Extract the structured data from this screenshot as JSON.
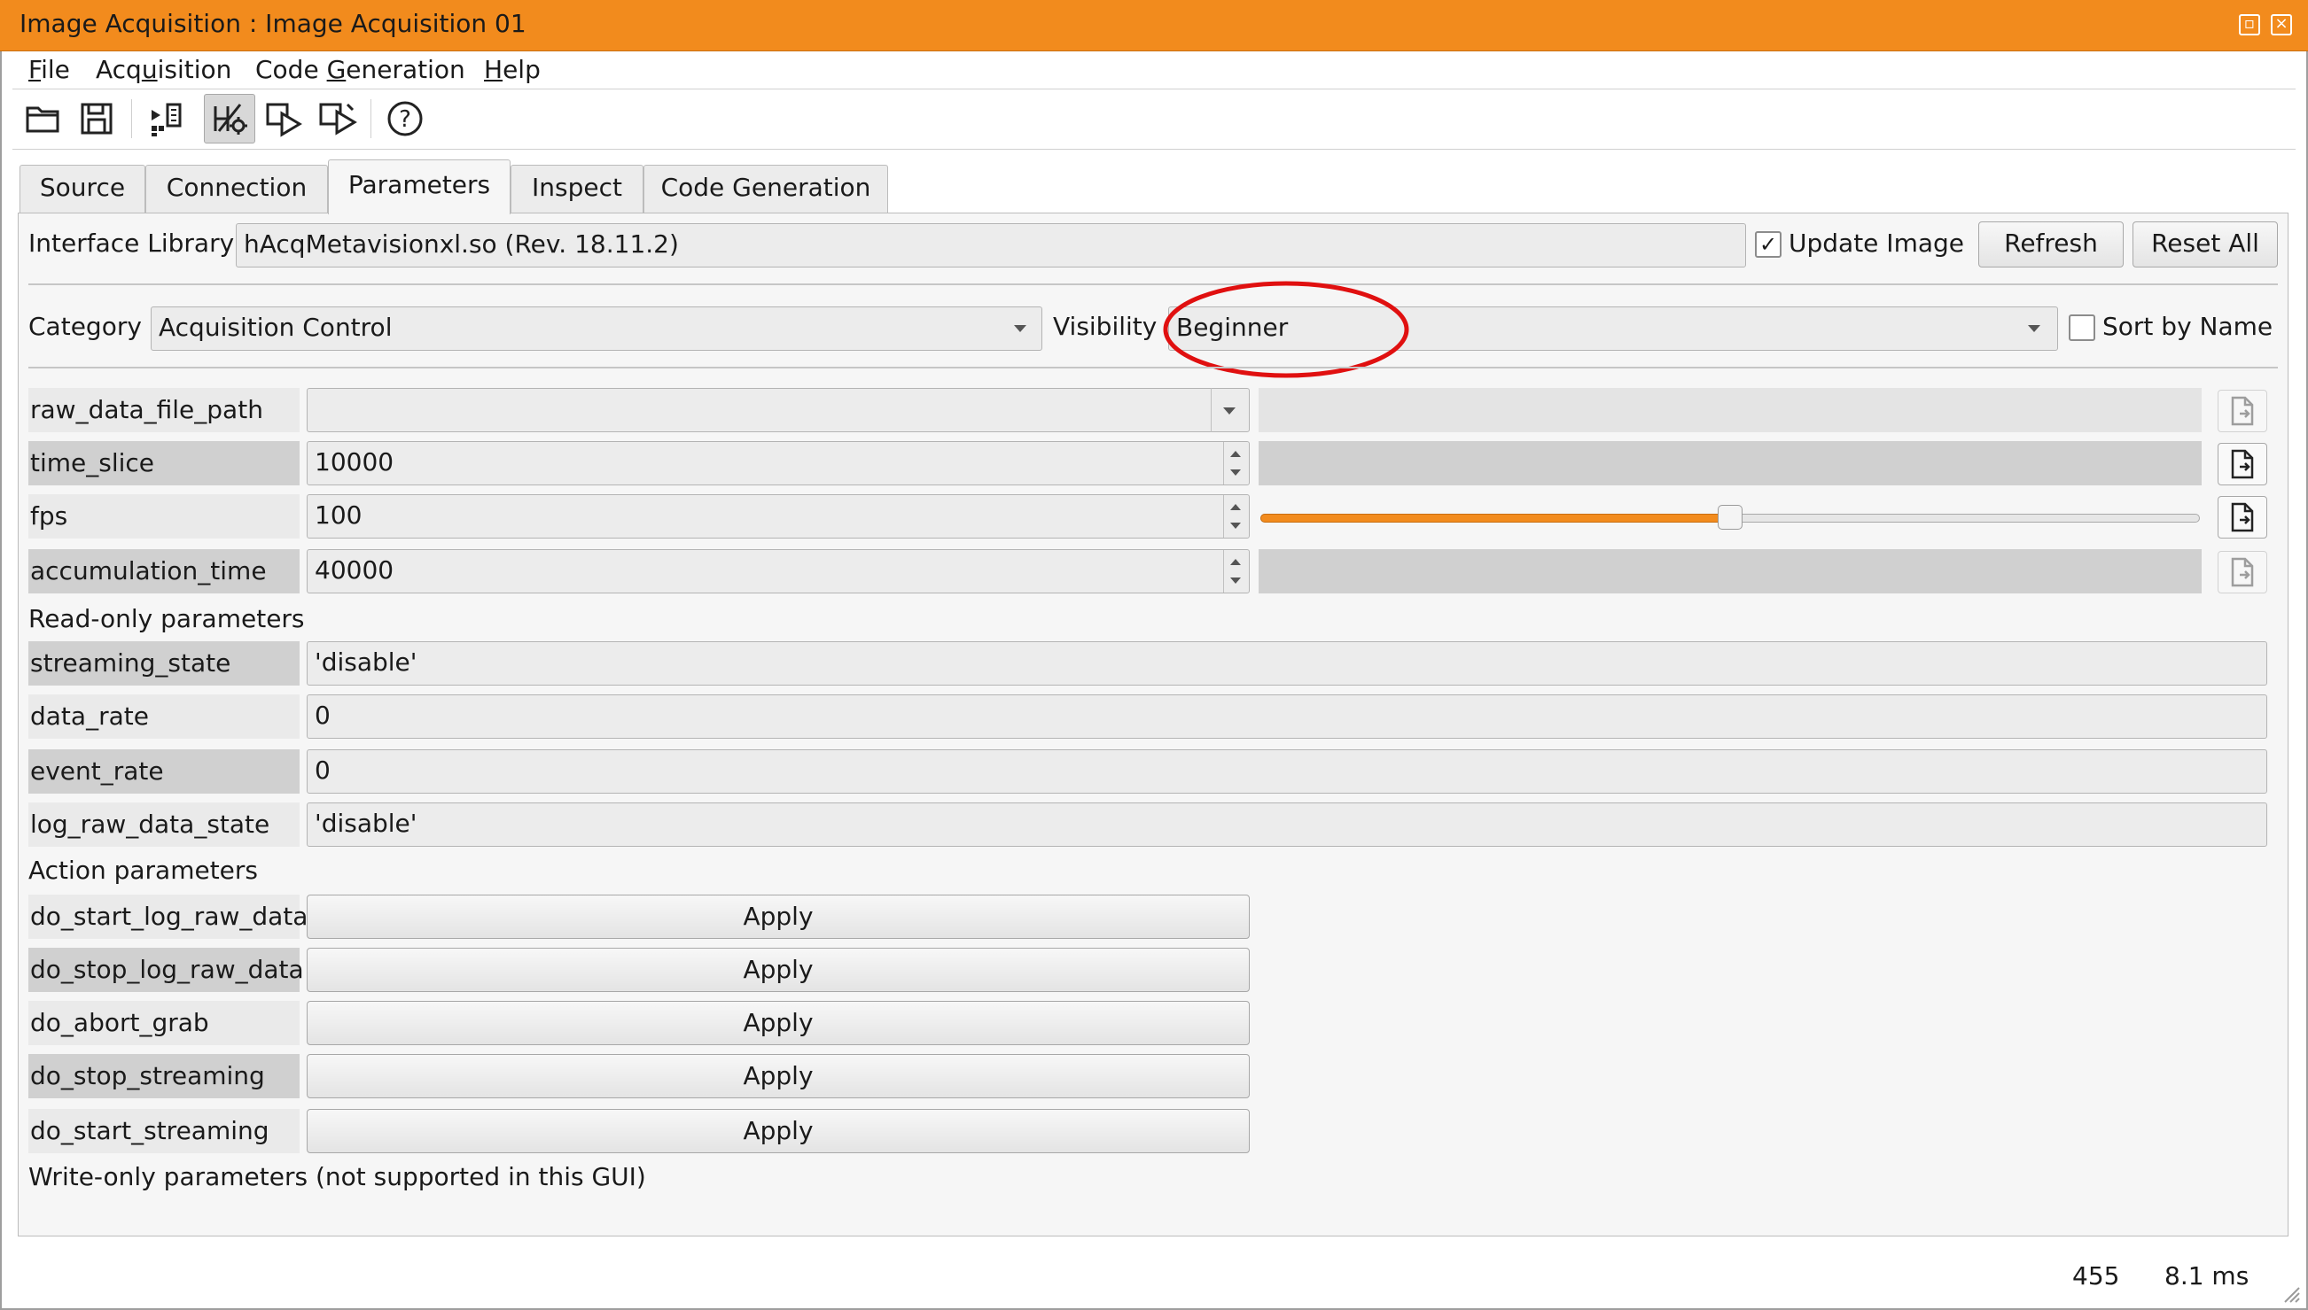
{
  "window": {
    "title": "Image Acquisition : Image Acquisition 01",
    "accent_color": "#f28b1d"
  },
  "menu": {
    "items": [
      {
        "label": "File"
      },
      {
        "label": "Acquisition"
      },
      {
        "label": "Code Generation"
      },
      {
        "label": "Help"
      }
    ]
  },
  "toolbar": {
    "buttons": [
      {
        "icon": "open-folder-icon"
      },
      {
        "icon": "save-disk-icon"
      },
      {
        "icon": "detect-devices-icon"
      },
      {
        "icon": "acquisition-settings-icon",
        "active": true
      },
      {
        "icon": "snap-image-icon"
      },
      {
        "icon": "live-image-icon"
      },
      {
        "icon": "help-icon"
      }
    ]
  },
  "tabs": [
    {
      "label": "Source"
    },
    {
      "label": "Connection"
    },
    {
      "label": "Parameters",
      "active": true
    },
    {
      "label": "Inspect"
    },
    {
      "label": "Code Generation"
    }
  ],
  "interface": {
    "label": "Interface Library",
    "value": "hAcqMetavisionxl.so (Rev. 18.11.2)",
    "update_image_label": "Update Image",
    "update_image_checked": true,
    "refresh_label": "Refresh",
    "reset_all_label": "Reset All"
  },
  "filter": {
    "category_label": "Category",
    "category_value": "Acquisition Control",
    "visibility_label": "Visibility",
    "visibility_value": "Beginner",
    "sort_label": "Sort by Name",
    "sort_checked": false,
    "highlight_color": "#e01010"
  },
  "params": {
    "raw_data_file_path": {
      "name": "raw_data_file_path",
      "value": ""
    },
    "time_slice": {
      "name": "time_slice",
      "value": "10000"
    },
    "fps": {
      "name": "fps",
      "value": "100",
      "slider_fraction": 0.5
    },
    "accumulation_time": {
      "name": "accumulation_time",
      "value": "40000"
    }
  },
  "readonly": {
    "section_label": "Read-only parameters",
    "items": [
      {
        "name": "streaming_state",
        "value": "'disable'"
      },
      {
        "name": "data_rate",
        "value": "0"
      },
      {
        "name": "event_rate",
        "value": "0"
      },
      {
        "name": "log_raw_data_state",
        "value": "'disable'"
      }
    ]
  },
  "actions": {
    "section_label": "Action parameters",
    "apply_label": "Apply",
    "items": [
      {
        "name": "do_start_log_raw_data"
      },
      {
        "name": "do_stop_log_raw_data"
      },
      {
        "name": "do_abort_grab"
      },
      {
        "name": "do_stop_streaming"
      },
      {
        "name": "do_start_streaming"
      }
    ]
  },
  "writeonly_note": "Write-only parameters (not supported in this GUI)",
  "status": {
    "count": "455",
    "time": "8.1 ms"
  }
}
